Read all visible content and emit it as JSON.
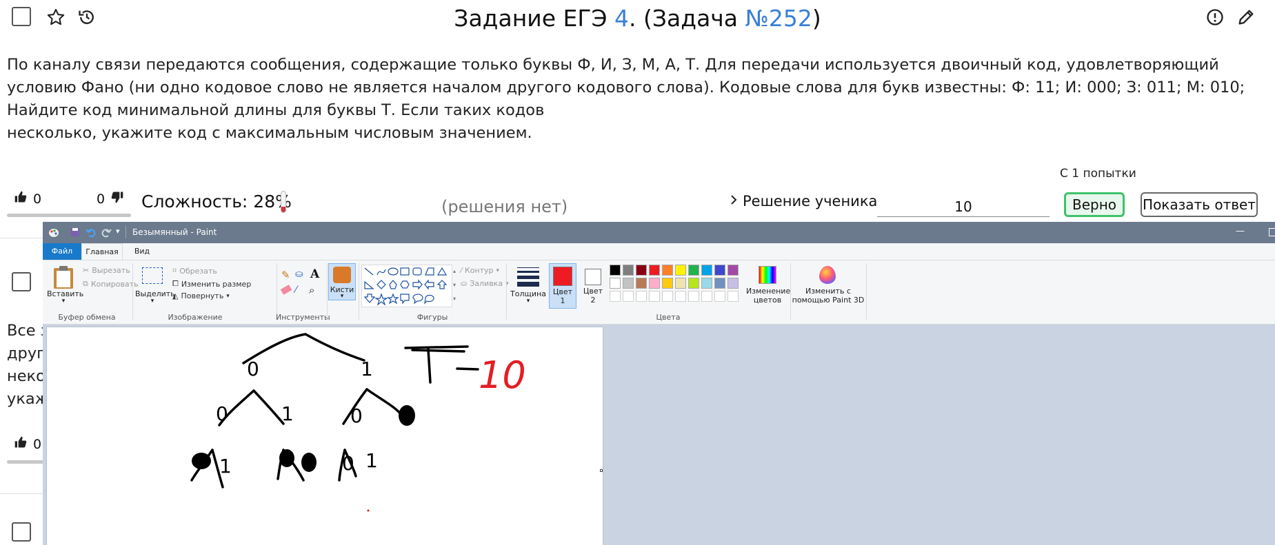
{
  "task": {
    "title_prefix": "Задание ЕГЭ ",
    "title_exam_link": "4",
    "title_middle": ". (Задача ",
    "title_task_link": "№252",
    "title_suffix": ")",
    "text_lines": [
      "По каналу связи передаются сообщения, содержащие только буквы Ф, И, З, М, А, Т. Для передачи используется двоичный код, удовлетворяющий",
      "условию Фано (ни одно кодовое слово не является началом другого кодового слова). Кодовые слова для букв известны: Ф: 11; И: 000; З: 011; М: 010;",
      "Найдите код минимальной длины для буквы Т. Если таких кодов",
      "несколько, укажите код с максимальным числовым значением."
    ],
    "likes": "0",
    "dislikes": "0",
    "complexity_label": "Сложность: 28%",
    "complexity_value": 0.28,
    "no_solution": "(решения нет)",
    "attempts": "С 1 попытки",
    "student_solution": "Решение ученика",
    "answer_value": "10",
    "correct_button": "Верно",
    "show_answer_button": "Показать ответ"
  },
  "second_card": {
    "text_fragments": [
      "Все з",
      "друг",
      "неко",
      "укаж"
    ],
    "likes": "0"
  },
  "paint": {
    "window_title": "Безымянный - Paint",
    "tabs": [
      "Файл",
      "Главная",
      "Вид"
    ],
    "clipboard": {
      "paste": "Вставить",
      "cut": "Вырезать",
      "copy": "Копировать",
      "group": "Буфер обмена"
    },
    "image": {
      "select": "Выделить",
      "crop": "Обрезать",
      "resize": "Изменить размер",
      "rotate": "Повернуть",
      "group": "Изображение"
    },
    "tools_group": "Инструменты",
    "brushes": "Кисти",
    "shapes": {
      "outline": "Контур",
      "fill": "Заливка",
      "group": "Фигуры"
    },
    "thickness": "Толщина",
    "color1": "Цвет 1",
    "color2": "Цвет 2",
    "colors_group": "Цвета",
    "edit_colors": "Изменение цветов",
    "paint3d": "Изменить с помощью Paint 3D",
    "palette_row1": [
      "#000000",
      "#7f7f7f",
      "#880015",
      "#ed1c24",
      "#ff7f27",
      "#fff200",
      "#22b14c",
      "#00a2e8",
      "#3f48cc",
      "#a349a4"
    ],
    "palette_row2": [
      "#ffffff",
      "#c3c3c3",
      "#b97a57",
      "#ffaec9",
      "#ffc90e",
      "#efe4b0",
      "#b5e61d",
      "#99d9ea",
      "#7092be",
      "#c8bfe7"
    ],
    "color1_hex": "#ed1c24",
    "drawing": {
      "tree_root_labels": [
        "0",
        "1"
      ],
      "left_children": [
        "0",
        "1"
      ],
      "right_children": [
        "0"
      ],
      "leaf_labels": [
        "1",
        "0",
        "1"
      ],
      "letter": "Т",
      "answer": "10",
      "answer_color": "#e31e24"
    }
  }
}
